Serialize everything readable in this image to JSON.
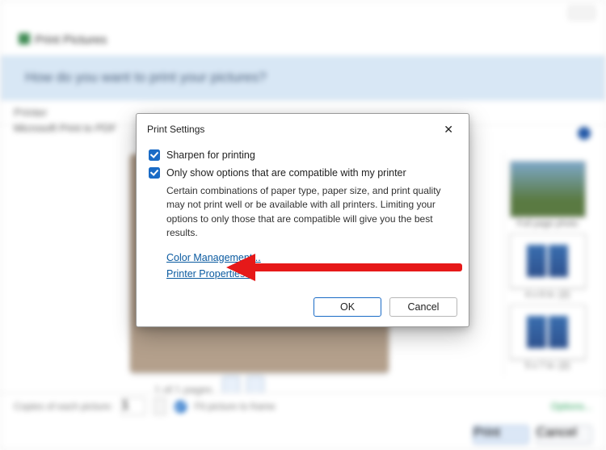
{
  "parent_window": {
    "title": "Print Pictures",
    "prompt": "How do you want to print your pictures?",
    "printer_label": "Printer",
    "printer_value": "Microsoft Print to PDF",
    "paginator": "1 of 1 pages",
    "thumbs": [
      "Full page photo",
      "4 x 6 in. (2)",
      "5 x 7 in. (2)"
    ],
    "copies_label": "Copies of each picture:",
    "copies_value": "1",
    "fit_label": "Fit picture to frame",
    "options_link": "Options...",
    "print_button": "Print",
    "cancel_button": "Cancel"
  },
  "modal": {
    "title": "Print Settings",
    "close": "✕",
    "sharpen_label": "Sharpen for printing",
    "compat_label": "Only show options that are compatible with my printer",
    "compat_desc": "Certain combinations of paper type, paper size, and print quality may not print well or be available with all printers.  Limiting your options to only those that are compatible will give you the best results.",
    "color_mgmt": "Color Management...",
    "printer_props": "Printer Properties...",
    "ok": "OK",
    "cancel": "Cancel"
  }
}
